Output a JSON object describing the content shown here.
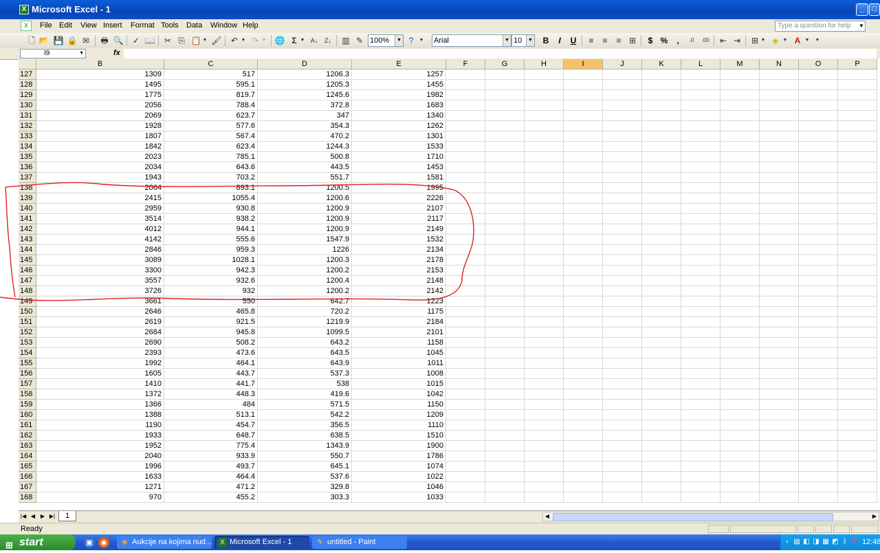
{
  "window": {
    "title": "Microsoft Excel - 1"
  },
  "menu": [
    "File",
    "Edit",
    "View",
    "Insert",
    "Format",
    "Tools",
    "Data",
    "Window",
    "Help"
  ],
  "help_placeholder": "Type a question for help",
  "toolbar": {
    "zoom": "100%",
    "font": "Arial",
    "font_size": "10"
  },
  "formula_bar": {
    "name_box": "I9",
    "fx": "fx",
    "content": ""
  },
  "columns": [
    "B",
    "C",
    "D",
    "E",
    "F",
    "G",
    "H",
    "I",
    "J",
    "K",
    "L",
    "M",
    "N",
    "O",
    "P"
  ],
  "selected_column": "I",
  "rows": [
    {
      "n": "127",
      "b": "1309",
      "c": "517",
      "d": "1206.3",
      "e": "1257"
    },
    {
      "n": "128",
      "b": "1495",
      "c": "595.1",
      "d": "1205.3",
      "e": "1455"
    },
    {
      "n": "129",
      "b": "1775",
      "c": "819.7",
      "d": "1245.6",
      "e": "1982"
    },
    {
      "n": "130",
      "b": "2056",
      "c": "788.4",
      "d": "372.8",
      "e": "1683"
    },
    {
      "n": "131",
      "b": "2069",
      "c": "623.7",
      "d": "347",
      "e": "1340"
    },
    {
      "n": "132",
      "b": "1928",
      "c": "577.6",
      "d": "354.3",
      "e": "1262"
    },
    {
      "n": "133",
      "b": "1807",
      "c": "567.4",
      "d": "470.2",
      "e": "1301"
    },
    {
      "n": "134",
      "b": "1842",
      "c": "623.4",
      "d": "1244.3",
      "e": "1533"
    },
    {
      "n": "135",
      "b": "2023",
      "c": "785.1",
      "d": "500.8",
      "e": "1710"
    },
    {
      "n": "136",
      "b": "2034",
      "c": "643.6",
      "d": "443.5",
      "e": "1453"
    },
    {
      "n": "137",
      "b": "1943",
      "c": "703.2",
      "d": "551.7",
      "e": "1581"
    },
    {
      "n": "138",
      "b": "2064",
      "c": "893.1",
      "d": "1200.5",
      "e": "1995"
    },
    {
      "n": "139",
      "b": "2415",
      "c": "1055.4",
      "d": "1200.6",
      "e": "2226"
    },
    {
      "n": "140",
      "b": "2959",
      "c": "930.8",
      "d": "1200.9",
      "e": "2107"
    },
    {
      "n": "141",
      "b": "3514",
      "c": "938.2",
      "d": "1200.9",
      "e": "2117"
    },
    {
      "n": "142",
      "b": "4012",
      "c": "944.1",
      "d": "1200.9",
      "e": "2149"
    },
    {
      "n": "143",
      "b": "4142",
      "c": "555.6",
      "d": "1547.9",
      "e": "1532"
    },
    {
      "n": "144",
      "b": "2846",
      "c": "959.3",
      "d": "1226",
      "e": "2134"
    },
    {
      "n": "145",
      "b": "3089",
      "c": "1028.1",
      "d": "1200.3",
      "e": "2178"
    },
    {
      "n": "146",
      "b": "3300",
      "c": "942.3",
      "d": "1200.2",
      "e": "2153"
    },
    {
      "n": "147",
      "b": "3557",
      "c": "932.6",
      "d": "1200.4",
      "e": "2148"
    },
    {
      "n": "148",
      "b": "3726",
      "c": "932",
      "d": "1200.2",
      "e": "2142"
    },
    {
      "n": "149",
      "b": "3661",
      "c": "550",
      "d": "642.7",
      "e": "1223"
    },
    {
      "n": "150",
      "b": "2646",
      "c": "465.8",
      "d": "720.2",
      "e": "1175"
    },
    {
      "n": "151",
      "b": "2619",
      "c": "921.5",
      "d": "1219.9",
      "e": "2184"
    },
    {
      "n": "152",
      "b": "2684",
      "c": "945.8",
      "d": "1099.5",
      "e": "2101"
    },
    {
      "n": "153",
      "b": "2690",
      "c": "508.2",
      "d": "643.2",
      "e": "1158"
    },
    {
      "n": "154",
      "b": "2393",
      "c": "473.6",
      "d": "643.5",
      "e": "1045"
    },
    {
      "n": "155",
      "b": "1992",
      "c": "464.1",
      "d": "643.9",
      "e": "1011"
    },
    {
      "n": "156",
      "b": "1605",
      "c": "443.7",
      "d": "537.3",
      "e": "1008"
    },
    {
      "n": "157",
      "b": "1410",
      "c": "441.7",
      "d": "538",
      "e": "1015"
    },
    {
      "n": "158",
      "b": "1372",
      "c": "448.3",
      "d": "419.6",
      "e": "1042"
    },
    {
      "n": "159",
      "b": "1366",
      "c": "484",
      "d": "571.5",
      "e": "1150"
    },
    {
      "n": "160",
      "b": "1388",
      "c": "513.1",
      "d": "542.2",
      "e": "1209"
    },
    {
      "n": "161",
      "b": "1190",
      "c": "454.7",
      "d": "356.5",
      "e": "1110"
    },
    {
      "n": "162",
      "b": "1933",
      "c": "648.7",
      "d": "638.5",
      "e": "1510"
    },
    {
      "n": "163",
      "b": "1952",
      "c": "775.4",
      "d": "1343.9",
      "e": "1900"
    },
    {
      "n": "164",
      "b": "2040",
      "c": "933.9",
      "d": "550.7",
      "e": "1786"
    },
    {
      "n": "165",
      "b": "1996",
      "c": "493.7",
      "d": "645.1",
      "e": "1074"
    },
    {
      "n": "166",
      "b": "1633",
      "c": "464.4",
      "d": "537.6",
      "e": "1022"
    },
    {
      "n": "167",
      "b": "1271",
      "c": "471.2",
      "d": "329.8",
      "e": "1046"
    },
    {
      "n": "168",
      "b": "970",
      "c": "455.2",
      "d": "303.3",
      "e": "1033"
    }
  ],
  "sheet_tab": "1",
  "status": "Ready",
  "taskbar": {
    "start": "start",
    "tasks": [
      "Aukcije na kojima nud...",
      "Microsoft Excel - 1",
      "untitled - Paint"
    ],
    "clock": "12:48"
  },
  "annotation_color": "#e02020"
}
